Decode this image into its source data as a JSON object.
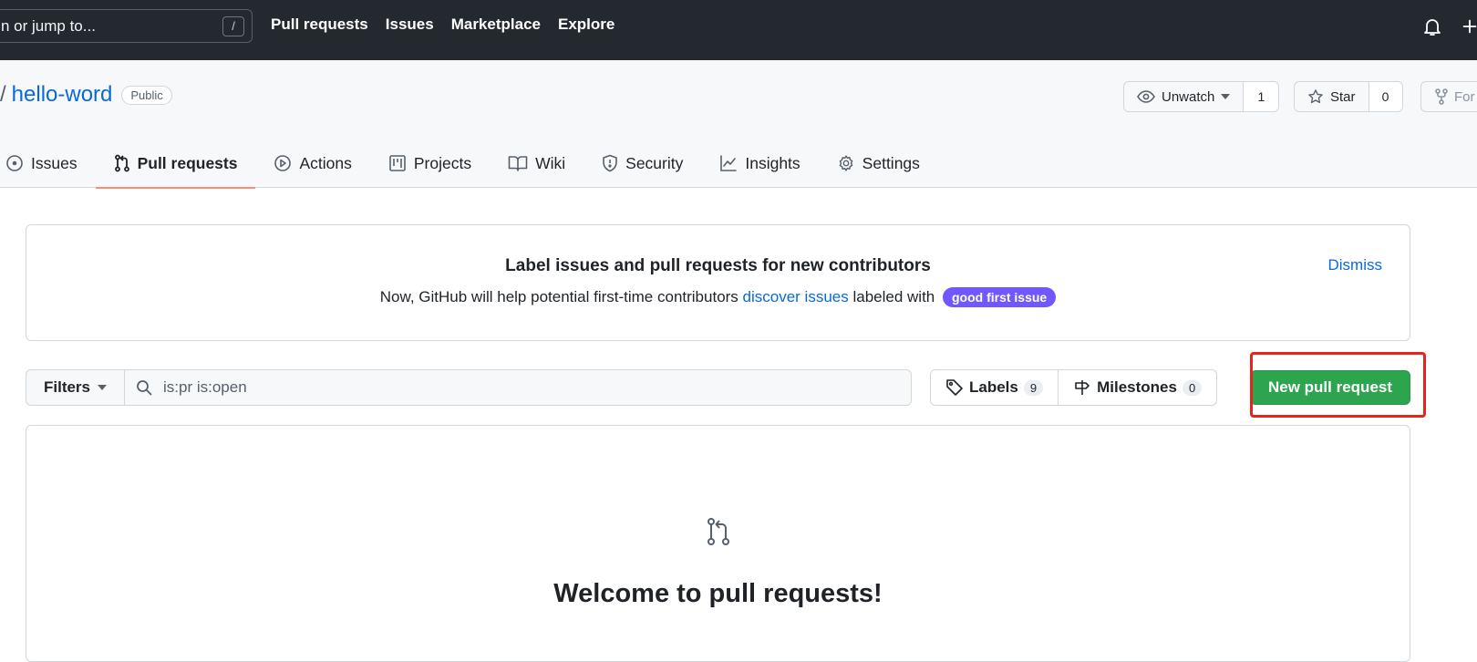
{
  "header": {
    "search_placeholder": "n or jump to...",
    "search_key": "/",
    "nav": [
      "Pull requests",
      "Issues",
      "Marketplace",
      "Explore"
    ],
    "icons": [
      "bell-icon",
      "plus-icon"
    ]
  },
  "repo": {
    "separator": "/",
    "name": "hello-word",
    "visibility": "Public",
    "watch": {
      "label": "Unwatch",
      "count": "1"
    },
    "star": {
      "label": "Star",
      "count": "0"
    },
    "fork": {
      "label": "For"
    }
  },
  "tabs": [
    {
      "label": "Issues",
      "icon": "issue-icon"
    },
    {
      "label": "Pull requests",
      "icon": "pull-request-icon",
      "selected": true
    },
    {
      "label": "Actions",
      "icon": "play-icon"
    },
    {
      "label": "Projects",
      "icon": "project-icon"
    },
    {
      "label": "Wiki",
      "icon": "book-icon"
    },
    {
      "label": "Security",
      "icon": "shield-icon"
    },
    {
      "label": "Insights",
      "icon": "graph-icon"
    },
    {
      "label": "Settings",
      "icon": "gear-icon"
    }
  ],
  "banner": {
    "title": "Label issues and pull requests for new contributors",
    "text_before": "Now, GitHub will help potential first-time contributors ",
    "link": "discover issues",
    "text_after": " labeled with ",
    "label": "good first issue",
    "label_color": "#7057ff",
    "dismiss": "Dismiss"
  },
  "toolbar": {
    "filters": "Filters",
    "search_value": "is:pr is:open",
    "labels": {
      "label": "Labels",
      "count": "9"
    },
    "milestones": {
      "label": "Milestones",
      "count": "0"
    },
    "new_pr": "New pull request",
    "new_pr_color": "#2da44e",
    "highlight_color": "#e8231b"
  },
  "blankslate": {
    "title": "Welcome to pull requests!"
  }
}
